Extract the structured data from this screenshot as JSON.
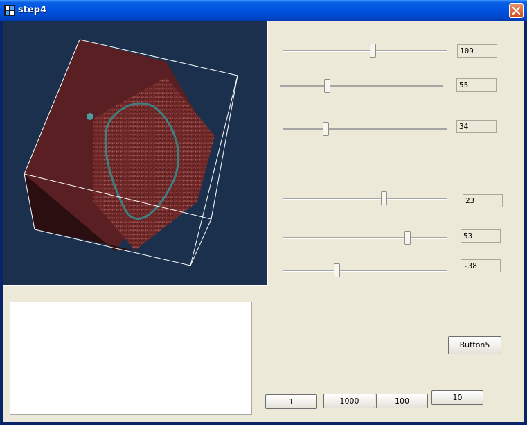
{
  "window": {
    "title": "step4",
    "close_icon": "close-icon",
    "app_icon": "app-icon"
  },
  "sliders": [
    {
      "value": "109",
      "level": 0.55
    },
    {
      "value": "55",
      "level": 0.28
    },
    {
      "value": "34",
      "level": 0.25
    },
    {
      "value": "23",
      "level": 0.62
    },
    {
      "value": "53",
      "level": 0.77
    },
    {
      "value": "-38",
      "level": 0.32
    }
  ],
  "buttons": {
    "button5": "Button5",
    "b1": "1",
    "b1000": "1000",
    "b100": "100",
    "b10": "10"
  },
  "colors": {
    "viewport_bg": "#1B304D",
    "title_bar": "#0053E0",
    "cube_texture": "#7A2A28"
  }
}
